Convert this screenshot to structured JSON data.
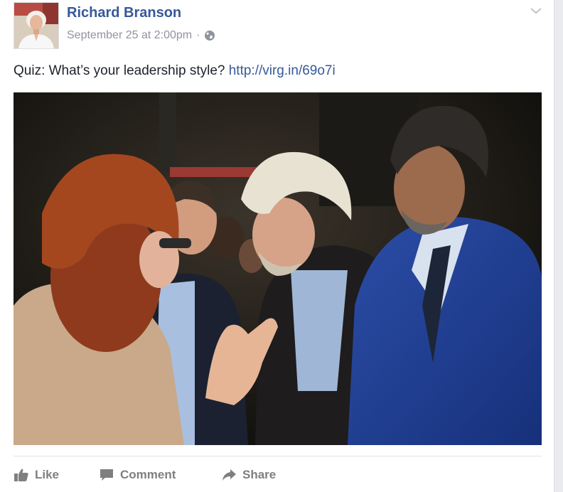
{
  "post": {
    "author": "Richard Branson",
    "timestamp": "September 25 at 2:00pm",
    "separator": "·",
    "audience_icon": "globe-icon",
    "text": "Quiz: What’s your leadership style?",
    "link": "http://virg.in/69o7i",
    "menu_icon": "chevron-down-icon"
  },
  "actions": {
    "like": "Like",
    "comment": "Comment",
    "share": "Share"
  },
  "colors": {
    "author_link": "#365899",
    "meta_text": "#90949c",
    "action_text": "#7f7f7f"
  }
}
